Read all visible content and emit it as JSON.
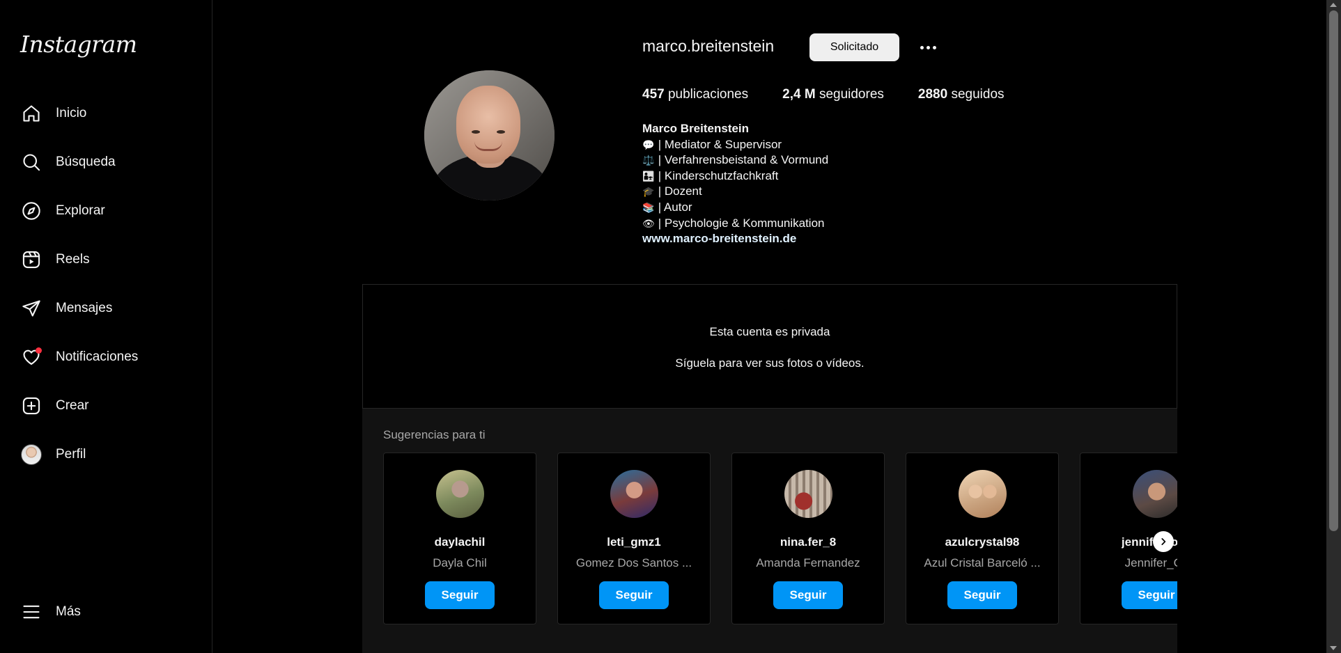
{
  "sidebar": {
    "logo": "Instagram",
    "items": [
      {
        "label": "Inicio",
        "icon": "home-icon"
      },
      {
        "label": "Búsqueda",
        "icon": "search-icon"
      },
      {
        "label": "Explorar",
        "icon": "compass-icon"
      },
      {
        "label": "Reels",
        "icon": "reels-icon"
      },
      {
        "label": "Mensajes",
        "icon": "send-icon"
      },
      {
        "label": "Notificaciones",
        "icon": "heart-icon"
      },
      {
        "label": "Crear",
        "icon": "plus-square-icon"
      },
      {
        "label": "Perfil",
        "icon": "avatar"
      }
    ],
    "more_label": "Más"
  },
  "profile": {
    "username": "marco.breitenstein",
    "requested_label": "Solicitado",
    "stats": {
      "posts_value": "457",
      "posts_label": "publicaciones",
      "followers_value": "2,4 M",
      "followers_label": "seguidores",
      "following_value": "2880",
      "following_label": "seguidos"
    },
    "bio": {
      "name": "Marco Breitenstein",
      "lines": [
        {
          "emoji": "💬",
          "text": "| Mediator & Supervisor"
        },
        {
          "emoji": "⚖️",
          "text": "| Verfahrensbeistand & Vormund"
        },
        {
          "emoji": "👨‍👧",
          "text": "| Kinderschutzfachkraft"
        },
        {
          "emoji": "🎓",
          "text": "| Dozent"
        },
        {
          "emoji": "📚",
          "text": "| Autor"
        },
        {
          "emoji": "👁",
          "text": "| Psychologie & Kommunikation"
        }
      ],
      "link": "www.marco-breitenstein.de"
    }
  },
  "private": {
    "title": "Esta cuenta es privada",
    "subtitle": "Síguela para ver sus fotos o vídeos."
  },
  "suggestions": {
    "title": "Sugerencias para ti",
    "follow_label": "Seguir",
    "cards": [
      {
        "username": "daylachil",
        "fullname": "Dayla Chil",
        "color": "#8a8f6a"
      },
      {
        "username": "leti_gmz1",
        "fullname": "Gomez Dos Santos ...",
        "color": "#7a3b3b"
      },
      {
        "username": "nina.fer_8",
        "fullname": "Amanda Fernandez",
        "color": "#8a6e62"
      },
      {
        "username": "azulcrystal98",
        "fullname": "Azul Cristal Barceló ...",
        "color": "#c9a27e"
      },
      {
        "username": "jennifer_oliv",
        "fullname": "Jennifer_Oli",
        "color": "#5c4a44"
      }
    ]
  }
}
